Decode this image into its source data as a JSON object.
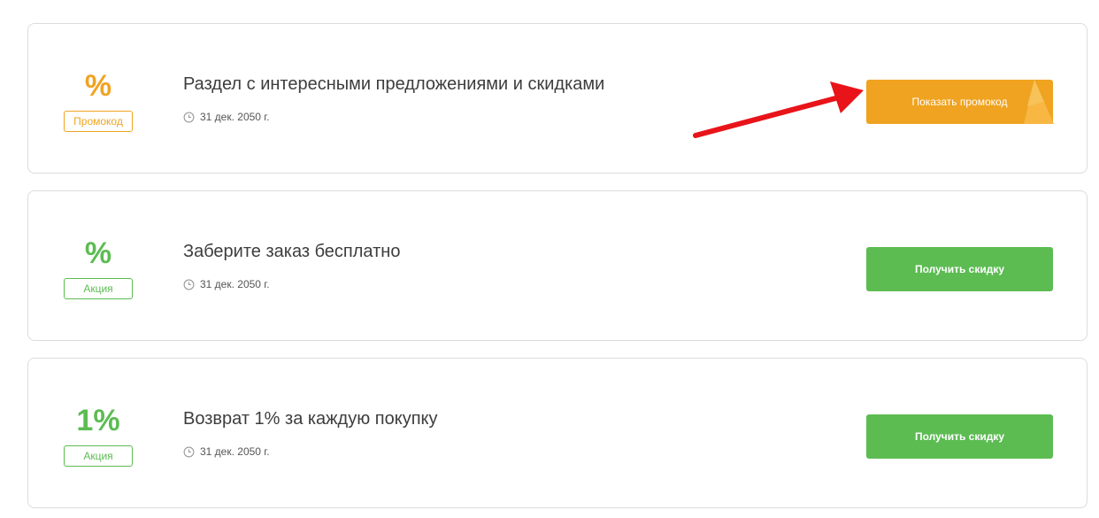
{
  "offers": [
    {
      "value": "%",
      "tag": "Промокод",
      "title": "Раздел с интересными предложениями и скидками",
      "date": "31 дек. 2050 г.",
      "button": "Показать промокод"
    },
    {
      "value": "%",
      "tag": "Акция",
      "title": "Заберите заказ бесплатно",
      "date": "31 дек. 2050 г.",
      "button": "Получить скидку"
    },
    {
      "value": "1%",
      "tag": "Акция",
      "title": "Возврат 1% за каждую покупку",
      "date": "31 дек. 2050 г.",
      "button": "Получить скидку"
    }
  ],
  "colors": {
    "promo_accent": "#f0a321",
    "deal_accent": "#5cbc52",
    "annotation_arrow": "#e8141a"
  },
  "icons": {
    "date": "clock-icon"
  }
}
